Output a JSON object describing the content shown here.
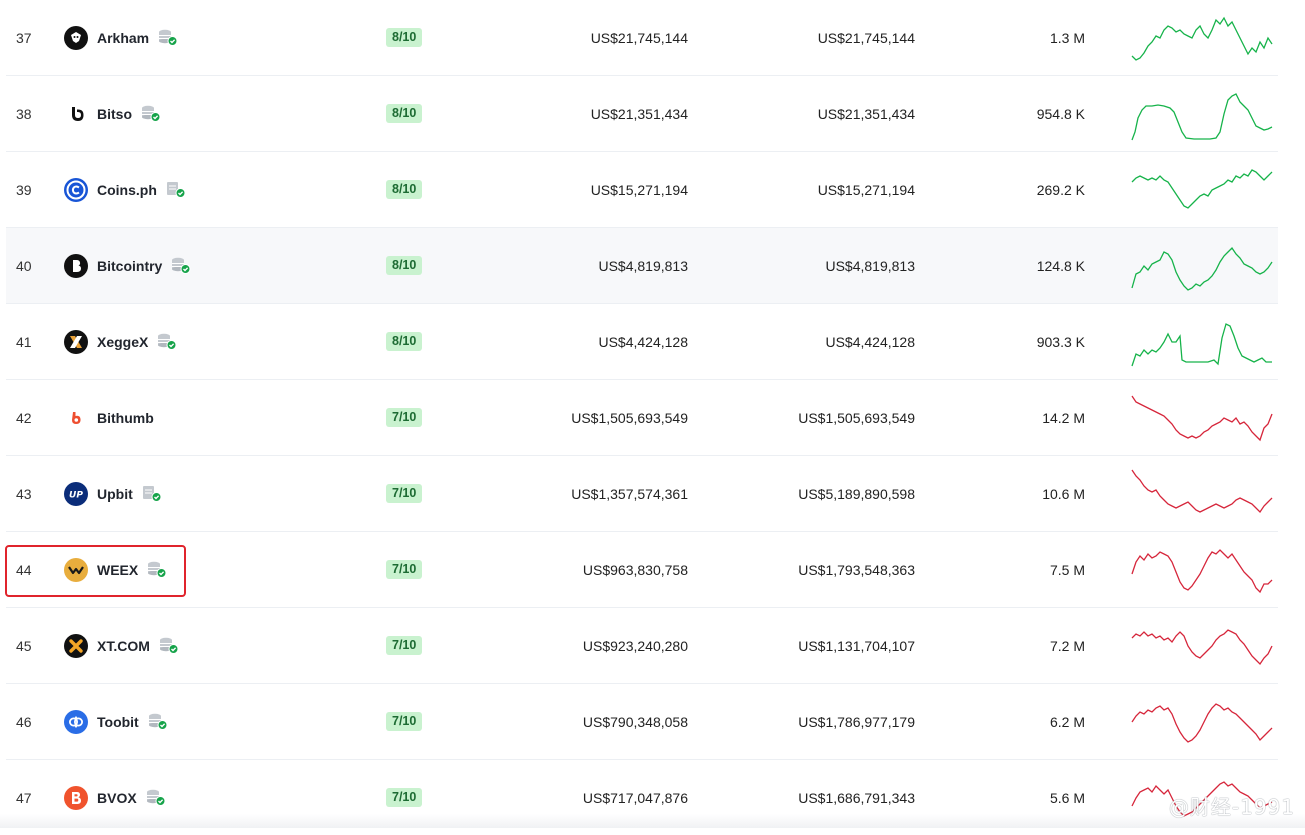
{
  "colors": {
    "score_bg": "#c9f2cf",
    "score_text": "#1d6b33",
    "spark_up": "#16b34a",
    "spark_down": "#d6263b",
    "highlight": "#e0242c"
  },
  "rows": [
    {
      "rank": "37",
      "name": "Arkham",
      "logo_icon": "arkham-logo-icon",
      "score": "8/10",
      "vol_24h": "US$21,745,144",
      "vol_normalized": "US$21,745,144",
      "visits": "1.3 M",
      "trend": "up"
    },
    {
      "rank": "38",
      "name": "Bitso",
      "logo_icon": "bitso-logo-icon",
      "score": "8/10",
      "vol_24h": "US$21,351,434",
      "vol_normalized": "US$21,351,434",
      "visits": "954.8 K",
      "trend": "up"
    },
    {
      "rank": "39",
      "name": "Coins.ph",
      "logo_icon": "coinsph-logo-icon",
      "score": "8/10",
      "vol_24h": "US$15,271,194",
      "vol_normalized": "US$15,271,194",
      "visits": "269.2 K",
      "trend": "up"
    },
    {
      "rank": "40",
      "name": "Bitcointry",
      "logo_icon": "bitcointry-logo-icon",
      "score": "8/10",
      "vol_24h": "US$4,819,813",
      "vol_normalized": "US$4,819,813",
      "visits": "124.8 K",
      "trend": "up"
    },
    {
      "rank": "41",
      "name": "XeggeX",
      "logo_icon": "xeggex-logo-icon",
      "score": "8/10",
      "vol_24h": "US$4,424,128",
      "vol_normalized": "US$4,424,128",
      "visits": "903.3 K",
      "trend": "up"
    },
    {
      "rank": "42",
      "name": "Bithumb",
      "logo_icon": "bithumb-logo-icon",
      "score": "7/10",
      "vol_24h": "US$1,505,693,549",
      "vol_normalized": "US$1,505,693,549",
      "visits": "14.2 M",
      "trend": "down"
    },
    {
      "rank": "43",
      "name": "Upbit",
      "logo_icon": "upbit-logo-icon",
      "score": "7/10",
      "vol_24h": "US$1,357,574,361",
      "vol_normalized": "US$5,189,890,598",
      "visits": "10.6 M",
      "trend": "down"
    },
    {
      "rank": "44",
      "name": "WEEX",
      "logo_icon": "weex-logo-icon",
      "score": "7/10",
      "vol_24h": "US$963,830,758",
      "vol_normalized": "US$1,793,548,363",
      "visits": "7.5 M",
      "trend": "down"
    },
    {
      "rank": "45",
      "name": "XT.COM",
      "logo_icon": "xtcom-logo-icon",
      "score": "7/10",
      "vol_24h": "US$923,240,280",
      "vol_normalized": "US$1,131,704,107",
      "visits": "7.2 M",
      "trend": "down"
    },
    {
      "rank": "46",
      "name": "Toobit",
      "logo_icon": "toobit-logo-icon",
      "score": "7/10",
      "vol_24h": "US$790,348,058",
      "vol_normalized": "US$1,786,977,179",
      "visits": "6.2 M",
      "trend": "down"
    },
    {
      "rank": "47",
      "name": "BVOX",
      "logo_icon": "bvox-logo-icon",
      "score": "7/10",
      "vol_24h": "US$717,047,876",
      "vol_normalized": "US$1,686,791,343",
      "visits": "5.6 M",
      "trend": "down"
    }
  ],
  "watermark": "@财经-1991"
}
